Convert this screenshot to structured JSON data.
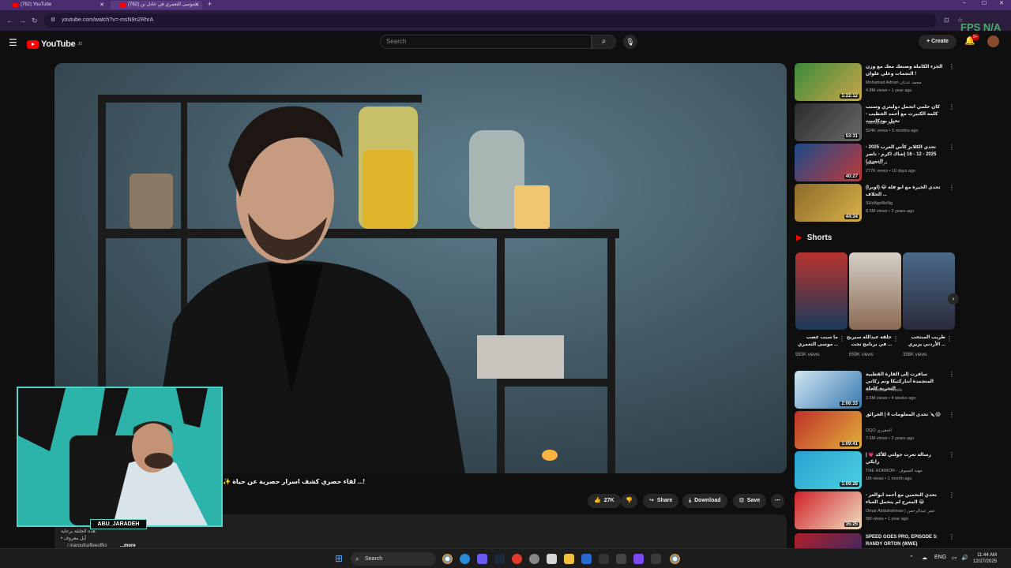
{
  "browser": {
    "tabs": [
      {
        "label": "(762) YouTube",
        "active": false
      },
      {
        "label": "(762) موسى التعمري في عادل بن...",
        "active": true
      }
    ],
    "url": "youtube.com/watch?v=-msN9n2RhrA",
    "overlay_text": "FPS  N/A"
  },
  "header": {
    "logo_text": "YouTube",
    "logo_sup": "JO",
    "search_placeholder": "Search",
    "create_label": "Create",
    "notifications_badge": "9+"
  },
  "video": {
    "title_line": "✨ لقاء حصري كشف اسرار حصرية عن حياة ...!",
    "actions": {
      "like_count": "27K",
      "share_label": "Share",
      "download_label": "Download",
      "save_label": "Save"
    },
    "description": {
      "line1": "هذه الحلقة برعاية:",
      "line2": "• أبل معروف",
      "line3": "/ maroufcoffeeoffici",
      "more": "...more"
    }
  },
  "webcam": {
    "name": "ABU_JARADEH"
  },
  "recommendations_top": [
    {
      "title": "الجزء الكاملة وصنعك معك مع وزن النجمات وعلي علوان !",
      "channel": "Mohamad Adnan محمد عدنان",
      "views": "4.8M views",
      "age": "1 year ago",
      "duration": "1:22:12"
    },
    {
      "title": "كان حلمي اتحمل دوليتري وسبب كلمة الكبيرت مع أحمد الخطيب - تخيل بودكاست",
      "channel": "Takhayal - تخيل",
      "views": "524K views",
      "age": "5 months ago",
      "duration": "53:31"
    },
    {
      "title": "تحدي الكلابز كأس العرب 2025 - 2025 - 12 - 16 (شاك اكرم - ناصر التمري)",
      "channel": "فراند الكلابز",
      "views": "277K views",
      "age": "10 days ago",
      "duration": "40:27"
    },
    {
      "title": "تحدي الخيرة مع ابو فلة 😂 (اوبرا) الحلاف ...",
      "channel": "SHoNgxBoNg",
      "views": "8.5M views",
      "age": "2 years ago",
      "duration": "44:34"
    }
  ],
  "shorts": {
    "heading": "Shorts",
    "items": [
      {
        "title": "ما سبب غضب موسى التعمري ...",
        "views": "983K views"
      },
      {
        "title": "حلقة عبدالله سيريح في برنامج تحت ...",
        "views": "659K views"
      },
      {
        "title": "طريب المنتخب الأردني يزيري ...",
        "views": "398K views"
      }
    ]
  },
  "recommendations_bottom": [
    {
      "title": "سافرت إلى القارة القطبية المتجمدة أنتاركتيكا وتم زكاتي التجربة كاملة",
      "channel": "Ibn Hattuta Travels",
      "views": "3.6M views",
      "age": "4 weeks ago",
      "duration": "2:06:33"
    },
    {
      "title": "تحدي المعلومات 4 | الحرائق 🔪😱",
      "channel": "OQO الحقيري",
      "views": "7.6M views",
      "age": "2 years ago",
      "duration": "1:09:41"
    },
    {
      "title": "رسالة تعرت جولتي للأكد 💗 | رايكي",
      "channel": "THE HORROR - مهند السيوف",
      "views": "1M views",
      "age": "1 month ago",
      "duration": "1:09:28"
    },
    {
      "title": "تحدي التخمين مع أحمد ابوالعز - المعرح لم يتحمل الغباء 😂",
      "channel": "Omar Abdulrahman | عمر عبدالرحمن",
      "views": "5M views",
      "age": "1 year ago",
      "duration": "35:25"
    },
    {
      "title": "SPEED GOES PRO, EPISODE 5: RANDY ORTON (WWE)",
      "channel": "",
      "views": "",
      "age": "",
      "duration": ""
    }
  ],
  "taskbar": {
    "search_label": "Search",
    "lang": "ENG",
    "time": "11:44 AM",
    "date": "12/27/2025"
  }
}
